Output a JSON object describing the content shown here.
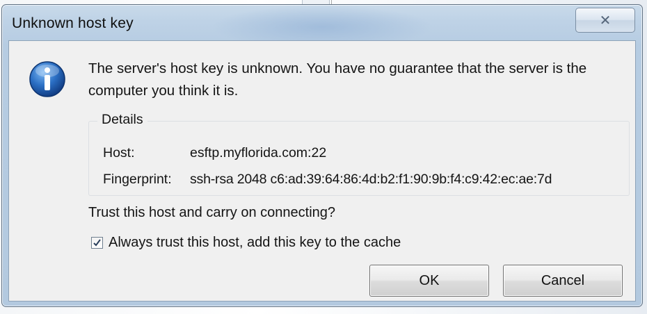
{
  "dialog": {
    "title": "Unknown host key",
    "close_icon": "close-icon",
    "message": "The server's host key is unknown. You have no guarantee that the server is the computer you think it is.",
    "details": {
      "legend": "Details",
      "host_label": "Host:",
      "host_value": "esftp.myflorida.com:22",
      "fingerprint_label": "Fingerprint:",
      "fingerprint_value": "ssh-rsa 2048 c6:ad:39:64:86:4d:b2:f1:90:9b:f4:c9:42:ec:ae:7d"
    },
    "question": "Trust this host and carry on connecting?",
    "checkbox": {
      "label": "Always trust this host, add this key to the cache",
      "checked": true
    },
    "buttons": {
      "ok": "OK",
      "cancel": "Cancel"
    },
    "icon": "information-icon"
  }
}
